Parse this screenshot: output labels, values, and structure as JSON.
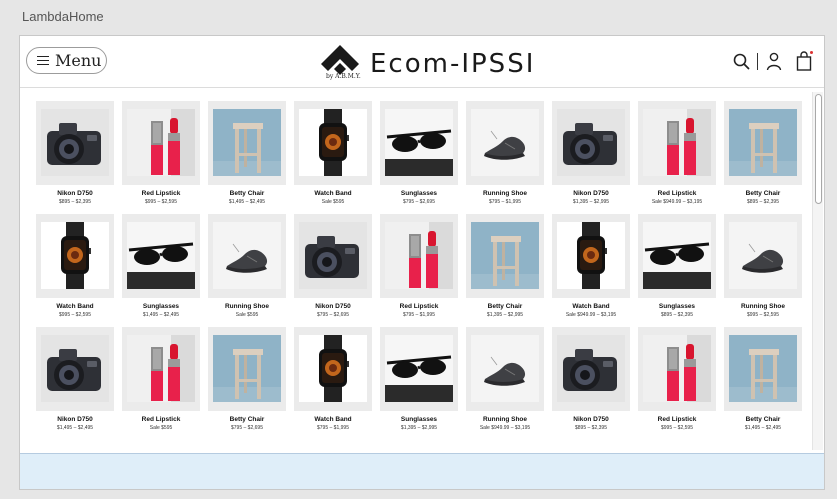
{
  "window": {
    "title": "LambdaHome"
  },
  "header": {
    "menu_label": "Menu",
    "brand_name": "Ecom-IPSSI",
    "logo_tagline": "by A.B.M.Y."
  },
  "products": [
    {
      "name": "Nikon D750",
      "price": "$895 – $2,395",
      "kind": "camera"
    },
    {
      "name": "Red Lipstick",
      "price": "$995 – $2,595",
      "kind": "lipstick"
    },
    {
      "name": "Betty Chair",
      "price": "$1,495 – $2,495",
      "kind": "chair"
    },
    {
      "name": "Watch Band",
      "price": "Sale $595",
      "kind": "watch"
    },
    {
      "name": "Sunglasses",
      "price": "$795 – $2,695",
      "kind": "sunglasses"
    },
    {
      "name": "Running Shoe",
      "price": "$795 – $1,995",
      "kind": "shoe"
    },
    {
      "name": "Nikon D750",
      "price": "$1,395 – $2,995",
      "kind": "camera"
    },
    {
      "name": "Red Lipstick",
      "price": "Sale $949.99 – $3,195",
      "kind": "lipstick"
    },
    {
      "name": "Betty Chair",
      "price": "$895 – $2,395",
      "kind": "chair"
    },
    {
      "name": "Watch Band",
      "price": "$995 – $2,595",
      "kind": "watch"
    },
    {
      "name": "Sunglasses",
      "price": "$1,495 – $2,495",
      "kind": "sunglasses"
    },
    {
      "name": "Running Shoe",
      "price": "Sale $595",
      "kind": "shoe"
    },
    {
      "name": "Nikon D750",
      "price": "$795 – $2,695",
      "kind": "camera"
    },
    {
      "name": "Red Lipstick",
      "price": "$795 – $1,995",
      "kind": "lipstick"
    },
    {
      "name": "Betty Chair",
      "price": "$1,395 – $2,995",
      "kind": "chair"
    },
    {
      "name": "Watch Band",
      "price": "Sale $949.99 – $3,195",
      "kind": "watch"
    },
    {
      "name": "Sunglasses",
      "price": "$895 – $2,395",
      "kind": "sunglasses"
    },
    {
      "name": "Running Shoe",
      "price": "$995 – $2,595",
      "kind": "shoe"
    },
    {
      "name": "Nikon D750",
      "price": "$1,495 – $2,495",
      "kind": "camera"
    },
    {
      "name": "Red Lipstick",
      "price": "Sale $595",
      "kind": "lipstick"
    },
    {
      "name": "Betty Chair",
      "price": "$795 – $2,695",
      "kind": "chair"
    },
    {
      "name": "Watch Band",
      "price": "$795 – $1,995",
      "kind": "watch"
    },
    {
      "name": "Sunglasses",
      "price": "$1,395 – $2,995",
      "kind": "sunglasses"
    },
    {
      "name": "Running Shoe",
      "price": "Sale $949.99 – $3,195",
      "kind": "shoe"
    },
    {
      "name": "Nikon D750",
      "price": "$895 – $2,395",
      "kind": "camera"
    },
    {
      "name": "Red Lipstick",
      "price": "$995 – $2,595",
      "kind": "lipstick"
    },
    {
      "name": "Betty Chair",
      "price": "$1,495 – $2,495",
      "kind": "chair"
    }
  ]
}
